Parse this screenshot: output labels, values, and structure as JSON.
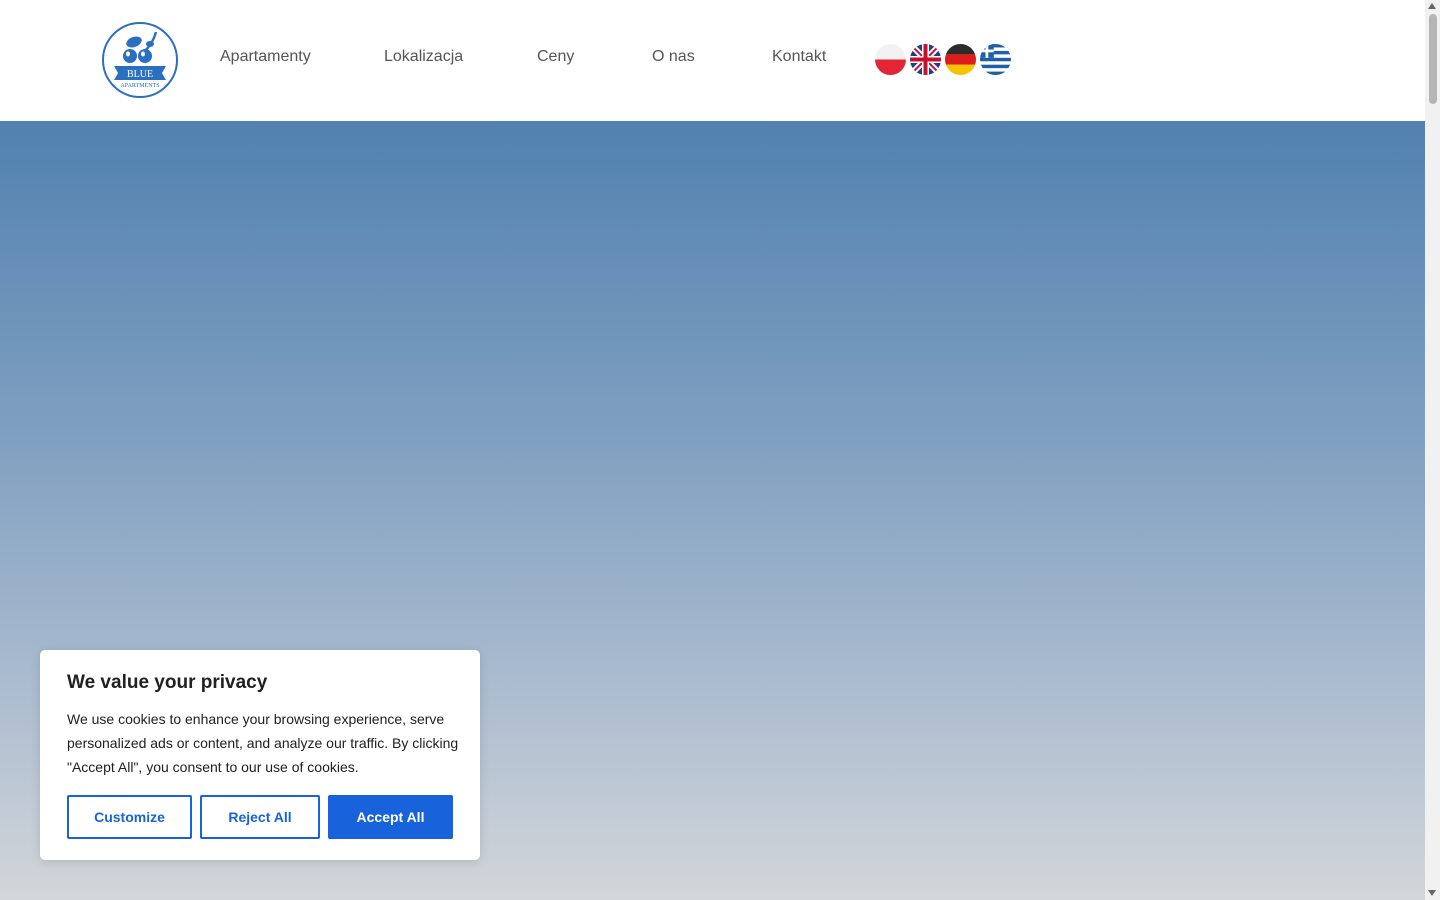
{
  "brand": {
    "logo_text": "BLUE",
    "logo_subtext": "APARTMENTS",
    "accent": "#2a6fc0"
  },
  "nav": {
    "items": [
      {
        "label": "Apartamenty"
      },
      {
        "label": "Lokalizacja"
      },
      {
        "label": "Ceny"
      },
      {
        "label": "O nas"
      },
      {
        "label": "Kontakt"
      }
    ]
  },
  "languages": [
    "polish-flag-icon",
    "uk-flag-icon",
    "german-flag-icon",
    "greek-flag-icon"
  ],
  "cookie_banner": {
    "title": "We value your privacy",
    "text": "We use cookies to enhance your browsing experience, serve personalized ads or content, and analyze our traffic. By clicking \"Accept All\", you consent to our use of cookies.",
    "customize_label": "Customize",
    "reject_label": "Reject All",
    "accept_label": "Accept All",
    "button_color": "#1863dc"
  }
}
